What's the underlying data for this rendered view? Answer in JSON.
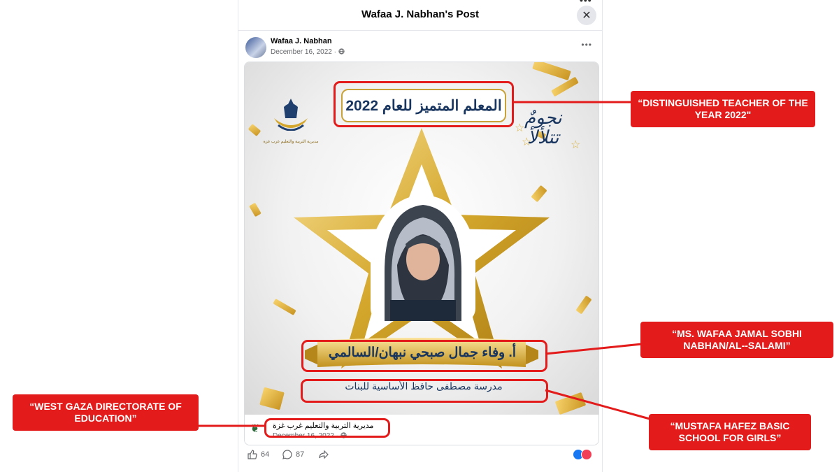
{
  "modal": {
    "title": "Wafaa J. Nabhan's Post",
    "close_glyph": "✕",
    "top_overflow_glyph": "•••"
  },
  "post": {
    "author": "Wafaa J. Nabhan",
    "date": "December 16, 2022 · ",
    "privacy_icon": "globe-icon",
    "more_glyph": "•••"
  },
  "poster": {
    "title_ar": "المعلم المتميز للعام 2022",
    "stars_ar_line1": "نجومٌ",
    "stars_ar_line2": "تتلألأ",
    "logo_caption_ar": "مديرية التربية والتعليم غرب غزة",
    "teacher_name_ar": "أ. وفاء جمال صبحي نبهان/السالمي",
    "school_ar": "مدرسة مصطفى حافظ الأساسية للبنات"
  },
  "shared_footer": {
    "source_ar": "مديرية التربية والتعليم غرب غزة",
    "date": "December 16, 2022 · "
  },
  "actions": {
    "like_count": "64",
    "comment_count": "87"
  },
  "annotations": {
    "title": "“DISTINGUISHED TEACHER OF THE YEAR 2022\"",
    "name": "“MS. WAFAA JAMAL SOBHI NABHAN/AL--SALAMI”",
    "school": "“MUSTAFA HAFEZ BASIC SCHOOL FOR GIRLS”",
    "directorate": "“WEST GAZA DIRECTORATE OF EDUCATION”"
  },
  "colors": {
    "annotation_red": "#e31b1b",
    "navy_text": "#18355f",
    "gold": "#d4a72c"
  }
}
